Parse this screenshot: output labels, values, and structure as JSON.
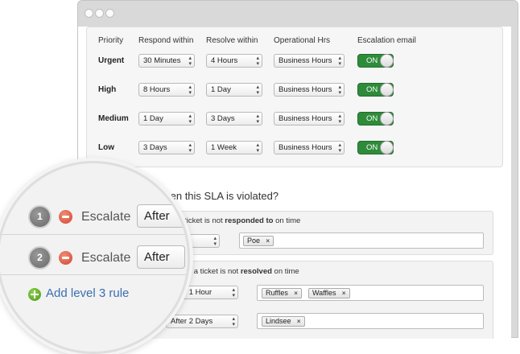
{
  "sla": {
    "headers": {
      "priority": "Priority",
      "respond": "Respond within",
      "resolve": "Resolve within",
      "hours": "Operational Hrs",
      "escalation": "Escalation email"
    },
    "rows": [
      {
        "priority": "Urgent",
        "respond": "30 Minutes",
        "resolve": "4 Hours",
        "hours": "Business Hours",
        "escalation": "ON"
      },
      {
        "priority": "High",
        "respond": "8 Hours",
        "resolve": "1 Day",
        "hours": "Business Hours",
        "escalation": "ON"
      },
      {
        "priority": "Medium",
        "respond": "1 Day",
        "resolve": "3 Days",
        "hours": "Business Hours",
        "escalation": "ON"
      },
      {
        "priority": "Low",
        "respond": "3 Days",
        "resolve": "1 Week",
        "hours": "Business Hours",
        "escalation": "ON"
      }
    ]
  },
  "violation": {
    "question": "when this SLA is violated?",
    "respond_rule": {
      "prefix": "en a ticket is not ",
      "bold": "responded to",
      "suffix": " on time",
      "select": "diately",
      "tags": [
        "Poe"
      ]
    },
    "resolve_rule": {
      "prefix": "y when a ticket is not ",
      "bold": "resolved",
      "suffix": " on time",
      "level1_select": "After 1 Hour",
      "level1_tags": [
        "Ruffles",
        "Waffles"
      ],
      "level2_label": "scalate",
      "level2_select": "After 2 Days",
      "level2_tags": [
        "Lindsee"
      ]
    }
  },
  "magnifier": {
    "levels": [
      {
        "number": "1",
        "action": "Escalate",
        "select": "After"
      },
      {
        "number": "2",
        "action": "Escalate",
        "select": "After"
      }
    ],
    "add_link": "Add level 3 rule"
  }
}
